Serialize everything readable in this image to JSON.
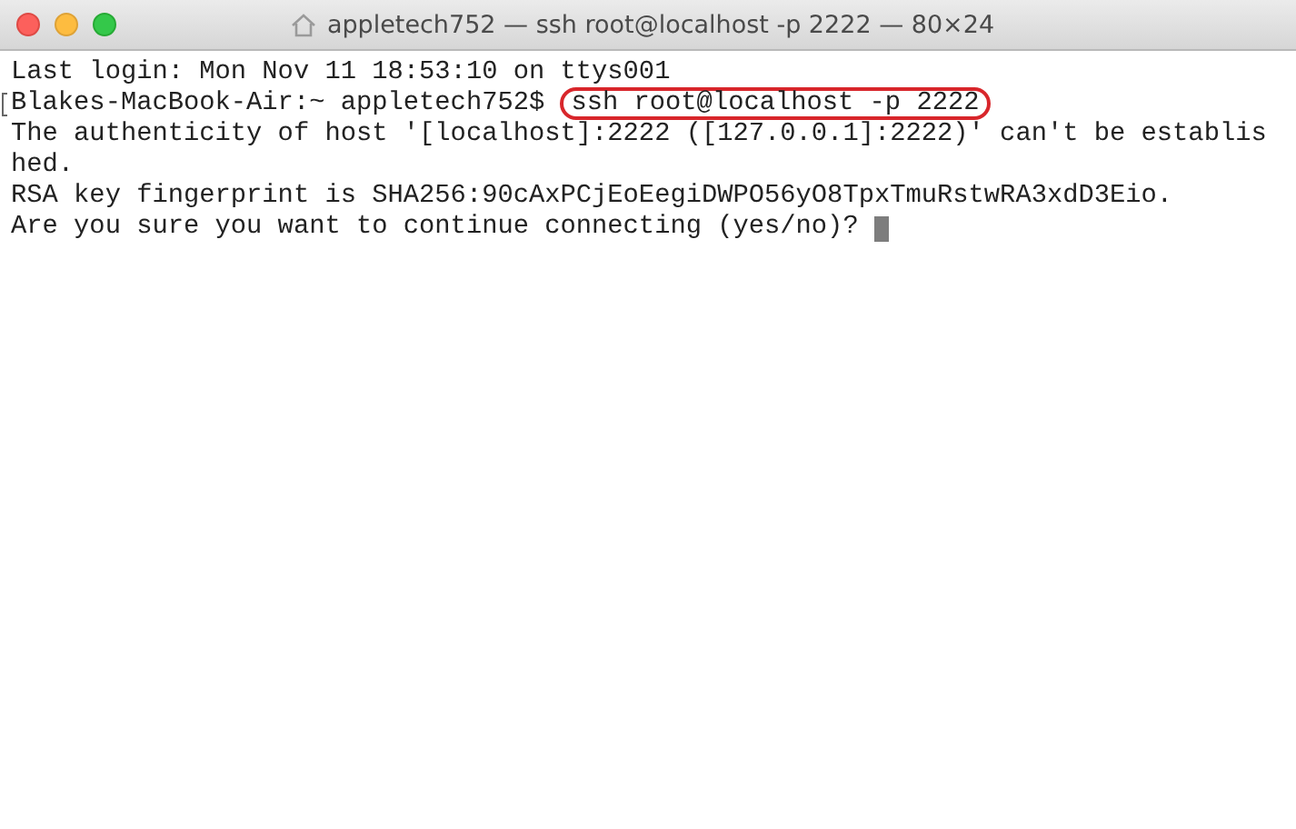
{
  "window": {
    "title": "appletech752 — ssh root@localhost -p 2222 — 80×24"
  },
  "lines": [
    {
      "kind": "output",
      "text": "Last login: Mon Nov 11 18:53:10 on ttys001"
    },
    {
      "kind": "prompt",
      "prompt": "Blakes-MacBook-Air:~ appletech752$",
      "command": "ssh root@localhost -p 2222",
      "highlighted": true
    },
    {
      "kind": "output",
      "text": "The authenticity of host '[localhost]:2222 ([127.0.0.1]:2222)' can't be establis"
    },
    {
      "kind": "output",
      "text": "hed."
    },
    {
      "kind": "output",
      "text": "RSA key fingerprint is SHA256:90cAxPCjEoEegiDWPO56yO8TpxTmuRstwRA3xdD3Eio."
    },
    {
      "kind": "output",
      "text": "Are you sure you want to continue connecting (yes/no)?",
      "cursor": true
    }
  ]
}
